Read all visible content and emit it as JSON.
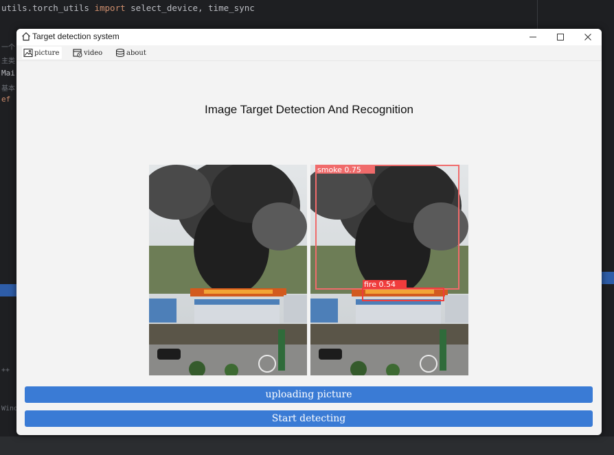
{
  "ide": {
    "code_line": "utils.torch_utils import select_device, time_sync",
    "gutter_fragments": [
      "一个",
      "主类",
      "Mai",
      "基本",
      "ef",
      "Windo",
      "++"
    ]
  },
  "window": {
    "title": "Target detection system",
    "controls": {
      "minimize": "minimize-icon",
      "maximize": "maximize-icon",
      "close": "close-icon"
    }
  },
  "tabs": [
    {
      "label": "picture",
      "icon": "picture-icon",
      "active": true
    },
    {
      "label": "video",
      "icon": "video-icon",
      "active": false
    },
    {
      "label": "about",
      "icon": "database-icon",
      "active": false
    }
  ],
  "main": {
    "heading": "Image Target Detection And Recognition",
    "detections": [
      {
        "label": "smoke 0.75",
        "color": "#f06b6b"
      },
      {
        "label": "fire 0.54",
        "color": "#f03c3c"
      }
    ]
  },
  "buttons": {
    "upload": "uploading picture",
    "detect": "Start detecting"
  },
  "colors": {
    "accent": "#3a7bd5"
  }
}
